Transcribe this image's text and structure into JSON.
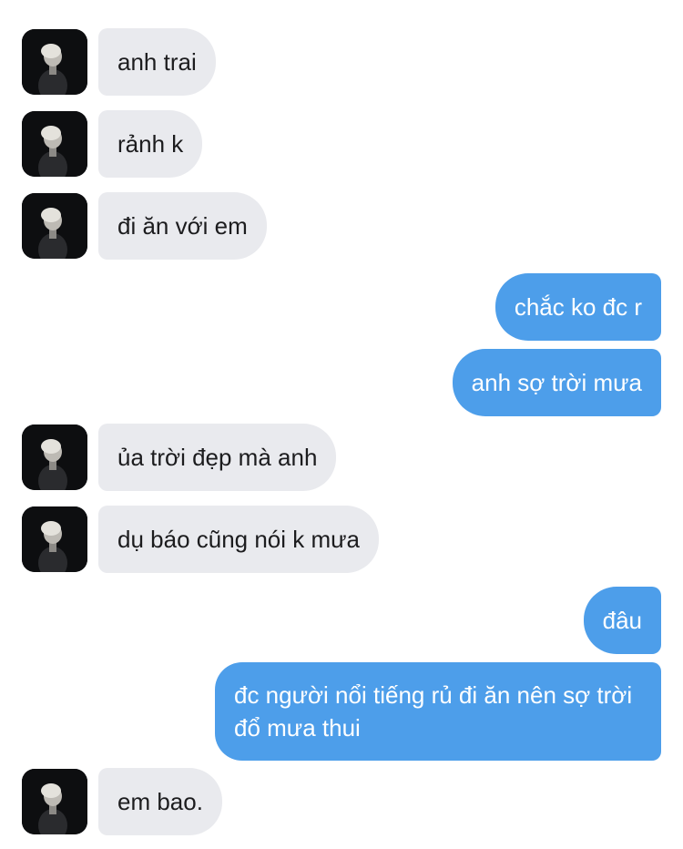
{
  "contact": {
    "avatar_icon": "contact-avatar-icon"
  },
  "messages": [
    {
      "from": "them",
      "text": "anh trai"
    },
    {
      "from": "them",
      "text": "rảnh k"
    },
    {
      "from": "them",
      "text": "đi ăn với em"
    },
    {
      "from": "me",
      "text": "chắc ko đc r"
    },
    {
      "from": "me",
      "text": "anh sợ trời mưa"
    },
    {
      "from": "them",
      "text": "ủa trời đẹp mà anh"
    },
    {
      "from": "them",
      "text": "dụ báo cũng nói k mưa"
    },
    {
      "from": "me",
      "text": "đâu"
    },
    {
      "from": "me",
      "text": "đc người nổi tiếng rủ đi ăn nên sợ trời đổ mưa thui"
    },
    {
      "from": "them",
      "text": "em bao."
    }
  ],
  "colors": {
    "incoming_bubble": "#e9eaee",
    "outgoing_bubble": "#4d9eea",
    "incoming_text": "#1c1c1e",
    "outgoing_text": "#ffffff"
  }
}
